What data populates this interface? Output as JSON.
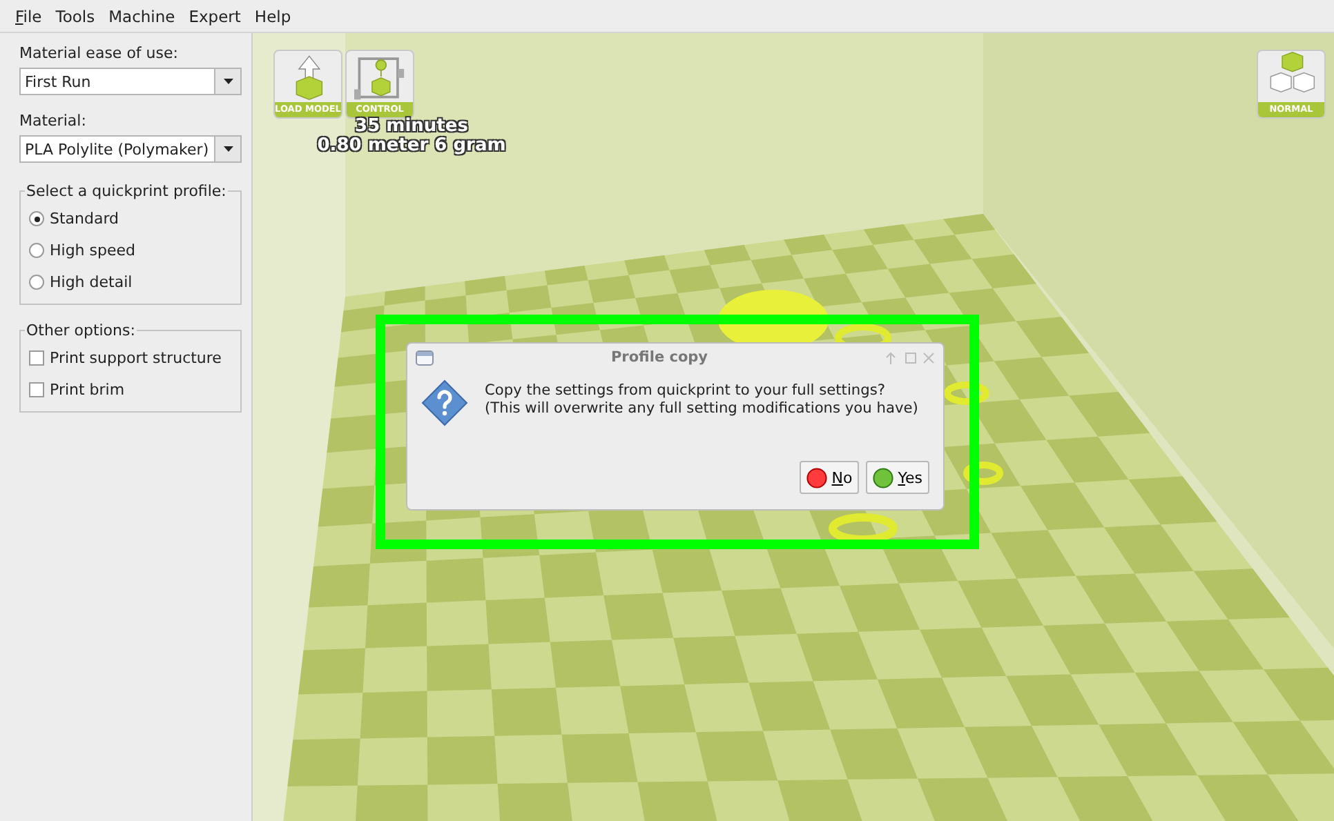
{
  "menu": [
    {
      "label": "File",
      "underline_first": true
    },
    {
      "label": "Tools",
      "underline_first": false
    },
    {
      "label": "Machine",
      "underline_first": false
    },
    {
      "label": "Expert",
      "underline_first": false
    },
    {
      "label": "Help",
      "underline_first": false
    }
  ],
  "sidebar": {
    "ease_label": "Material ease of use:",
    "ease_value": "First Run",
    "material_label": "Material:",
    "material_value": "PLA Polylite (Polymaker)",
    "profile_group": {
      "title": "Select a quickprint profile:",
      "options": [
        {
          "label": "Standard",
          "selected": true
        },
        {
          "label": "High speed",
          "selected": false
        },
        {
          "label": "High detail",
          "selected": false
        }
      ]
    },
    "options_group": {
      "title": "Other options:",
      "items": [
        {
          "label": "Print support structure",
          "checked": false
        },
        {
          "label": "Print brim",
          "checked": false
        }
      ]
    }
  },
  "toolbar": [
    {
      "kind": "load",
      "label": "LOAD MODEL"
    },
    {
      "kind": "control",
      "label": "CONTROL"
    }
  ],
  "view_button": {
    "label": "NORMAL"
  },
  "print_estimate": [
    "35 minutes",
    "0.80 meter 6 gram"
  ],
  "dialog": {
    "title": "Profile copy",
    "message_lines": [
      "Copy the settings from quickprint to your full settings?",
      "(This will overwrite any full setting modifications you have)"
    ],
    "buttons": [
      {
        "kind": "no",
        "label": "No",
        "underline_first": true
      },
      {
        "kind": "yes",
        "label": "Yes",
        "underline_first": true
      }
    ]
  }
}
